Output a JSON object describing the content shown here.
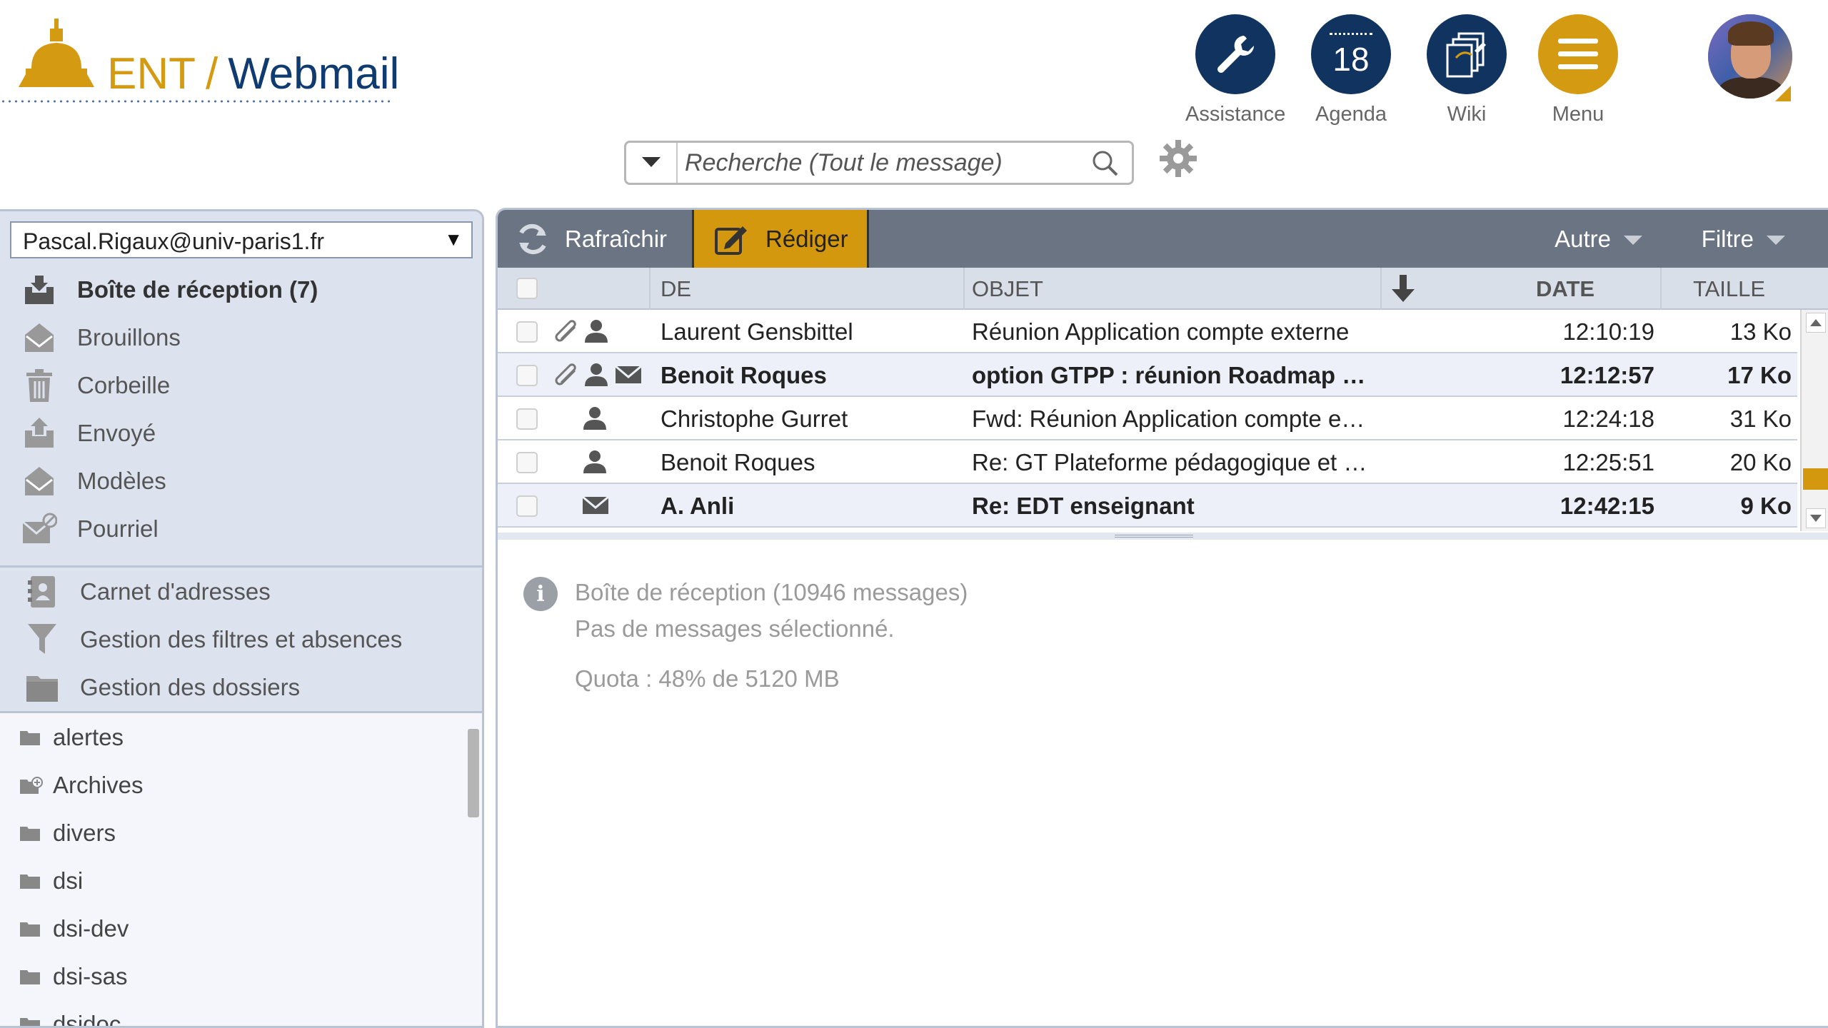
{
  "header": {
    "logo_ent": "ENT",
    "logo_slash": "/",
    "logo_webmail": "Webmail",
    "nav": [
      {
        "label": "Assistance",
        "icon": "wrench-icon"
      },
      {
        "label": "Agenda",
        "icon": "calendar-icon",
        "day": "18"
      },
      {
        "label": "Wiki",
        "icon": "wiki-icon"
      },
      {
        "label": "Menu",
        "icon": "menu-icon"
      }
    ]
  },
  "search": {
    "placeholder": "Recherche (Tout le message)"
  },
  "account": {
    "selected": "Pascal.Rigaux@univ-paris1.fr"
  },
  "folders": [
    {
      "label": "Boîte de réception (7)",
      "icon": "inbox-icon"
    },
    {
      "label": "Brouillons",
      "icon": "drafts-icon"
    },
    {
      "label": "Corbeille",
      "icon": "trash-icon"
    },
    {
      "label": "Envoyé",
      "icon": "sent-icon"
    },
    {
      "label": "Modèles",
      "icon": "templates-icon"
    },
    {
      "label": "Pourriel",
      "icon": "spam-icon"
    }
  ],
  "tools": [
    {
      "label": "Carnet d'adresses",
      "icon": "address-book-icon"
    },
    {
      "label": "Gestion des filtres et absences",
      "icon": "filter-icon"
    },
    {
      "label": "Gestion des dossiers",
      "icon": "folder-manage-icon"
    }
  ],
  "subfolders": [
    "alertes",
    "Archives",
    "divers",
    "dsi",
    "dsi-dev",
    "dsi-sas",
    "dsidoc"
  ],
  "toolbar": {
    "refresh": "Rafraîchir",
    "compose": "Rédiger",
    "other": "Autre",
    "filter": "Filtre"
  },
  "columns": {
    "from": "DE",
    "subject": "OBJET",
    "date": "DATE",
    "size": "TAILLE"
  },
  "messages": [
    {
      "from": "Laurent Gensbittel",
      "subject": "Réunion Application compte externe",
      "date": "12:10:19",
      "size": "13 Ko",
      "unread": false,
      "attachment": true,
      "envelope": false
    },
    {
      "from": "Benoit Roques",
      "subject": "option GTPP : réunion Roadmap …",
      "date": "12:12:57",
      "size": "17 Ko",
      "unread": true,
      "attachment": true,
      "envelope": true
    },
    {
      "from": "Christophe Gurret",
      "subject": "Fwd: Réunion Application compte e…",
      "date": "12:24:18",
      "size": "31 Ko",
      "unread": false,
      "attachment": false,
      "envelope": false
    },
    {
      "from": "Benoit Roques",
      "subject": "Re: GT Plateforme pédagogique et …",
      "date": "12:25:51",
      "size": "20 Ko",
      "unread": false,
      "attachment": false,
      "envelope": false
    },
    {
      "from": "A. Anli",
      "subject": "Re: EDT enseignant",
      "date": "12:42:15",
      "size": "9 Ko",
      "unread": true,
      "attachment": false,
      "envelope": true
    }
  ],
  "info": {
    "mailbox": "Boîte de réception (10946 messages)",
    "none_selected": "Pas de messages sélectionné.",
    "quota": "Quota : 48% de 5120 MB"
  },
  "colors": {
    "accent": "#d4980e",
    "navy": "#10335f",
    "toolbar": "#6a7482"
  }
}
